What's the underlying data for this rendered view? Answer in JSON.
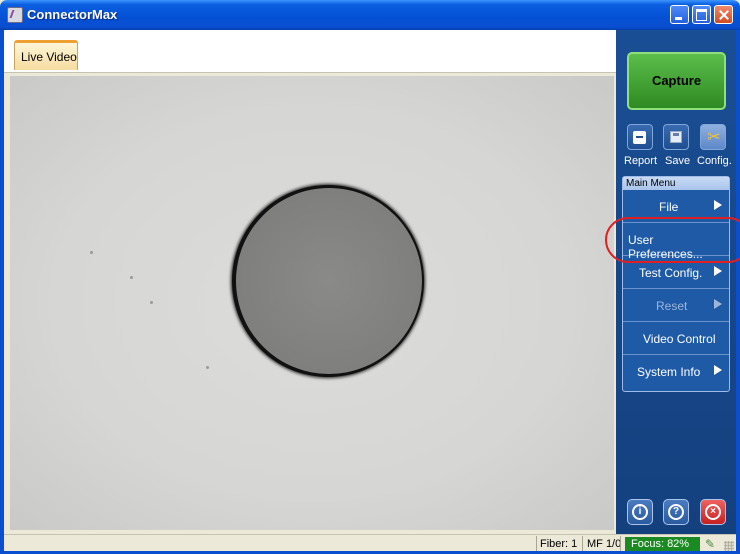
{
  "window": {
    "title": "ConnectorMax",
    "controls": [
      "minimize",
      "maximize",
      "close"
    ]
  },
  "tabs": [
    {
      "label": "Live Video",
      "selected": true
    }
  ],
  "toolbar": {
    "capture_label": "Capture",
    "tools": [
      {
        "label": "Report",
        "icon": "report-icon"
      },
      {
        "label": "Save",
        "icon": "save-icon"
      },
      {
        "label": "Config.",
        "icon": "config-icon",
        "selected": true
      }
    ]
  },
  "menu": {
    "header": "Main Menu",
    "items": [
      {
        "label": "File",
        "submenu": true,
        "enabled": true
      },
      {
        "label": "User Preferences...",
        "submenu": false,
        "enabled": true,
        "highlighted": true
      },
      {
        "label": "Test Config.",
        "submenu": true,
        "enabled": true
      },
      {
        "label": "Reset",
        "submenu": true,
        "enabled": false
      },
      {
        "label": "Video Control",
        "submenu": false,
        "enabled": true
      },
      {
        "label": "System Info",
        "submenu": true,
        "enabled": true
      }
    ]
  },
  "bottom_buttons": [
    {
      "icon": "info-icon",
      "glyph": "i"
    },
    {
      "icon": "help-icon",
      "glyph": "?"
    },
    {
      "icon": "exit-icon",
      "glyph": "×"
    }
  ],
  "status": {
    "fiber": "Fiber: 1",
    "mode": "MF 1/0",
    "focus": "Focus: 82%"
  },
  "colors": {
    "title_bar": "#0450d4",
    "panel": "#1a4e94",
    "capture": "#3fa22f",
    "focus": "#1c8a22",
    "highlight": "#e02020"
  }
}
